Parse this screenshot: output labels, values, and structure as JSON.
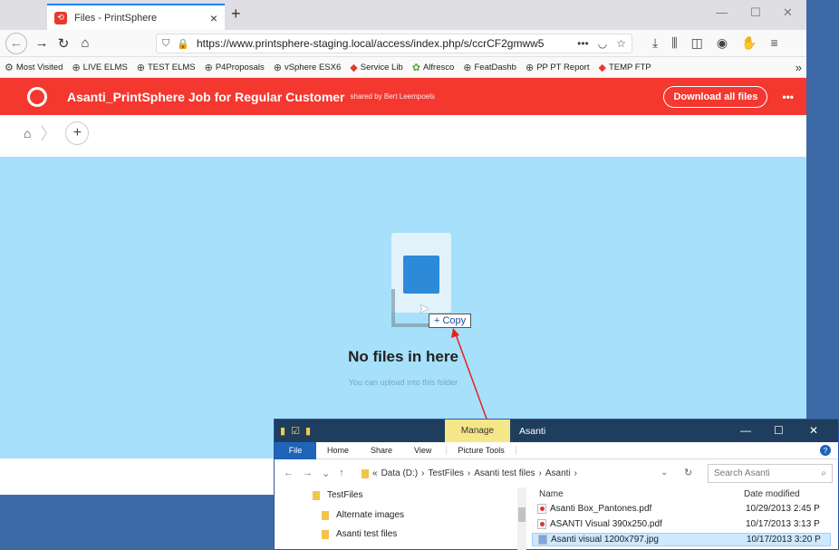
{
  "browser": {
    "tab_title": "Files - PrintSphere",
    "url": "https://www.printsphere-staging.local/access/index.php/s/ccrCF2gmww5",
    "url_more": "•••",
    "bookmarks": [
      {
        "label": "Most Visited",
        "icon": "gear-icon"
      },
      {
        "label": "LIVE ELMS",
        "icon": "globe-icon"
      },
      {
        "label": "TEST ELMS",
        "icon": "globe-icon"
      },
      {
        "label": "P4Proposals",
        "icon": "globe-icon"
      },
      {
        "label": "vSphere ESX6",
        "icon": "globe-icon"
      },
      {
        "label": "Service Lib",
        "icon": "diamond-icon"
      },
      {
        "label": "Alfresco",
        "icon": "alfresco-icon"
      },
      {
        "label": "FeatDashb",
        "icon": "globe-icon"
      },
      {
        "label": "PP PT Report",
        "icon": "globe-icon"
      },
      {
        "label": "TEMP FTP",
        "icon": "diamond-icon"
      }
    ]
  },
  "share": {
    "title": "Asanti_PrintSphere Job for Regular Customer",
    "shared_by": "shared by Bert Leempoels",
    "download_label": "Download all files",
    "more": "•••"
  },
  "empty": {
    "title": "No files in here",
    "subtitle": "You can upload into this folder",
    "copy_tip": "+ Copy"
  },
  "explorer": {
    "name": "Asanti",
    "manage": "Manage",
    "ribbon_tabs": [
      "File",
      "Home",
      "Share",
      "View",
      "Picture Tools"
    ],
    "path": [
      "«",
      "Data (D:)",
      "TestFiles",
      "Asanti test files",
      "Asanti"
    ],
    "search_placeholder": "Search Asanti",
    "tree": [
      "TestFiles",
      "Alternate images",
      "Asanti test files"
    ],
    "columns": {
      "name": "Name",
      "date": "Date modified"
    },
    "files": [
      {
        "name": "Asanti Box_Pantones.pdf",
        "date": "10/29/2013 2:45 P",
        "type": "pdf"
      },
      {
        "name": "ASANTI Visual 390x250.pdf",
        "date": "10/17/2013 3:13 P",
        "type": "pdf"
      },
      {
        "name": "Asanti visual 1200x797.jpg",
        "date": "10/17/2013 3:20 P",
        "type": "jpg"
      }
    ]
  }
}
